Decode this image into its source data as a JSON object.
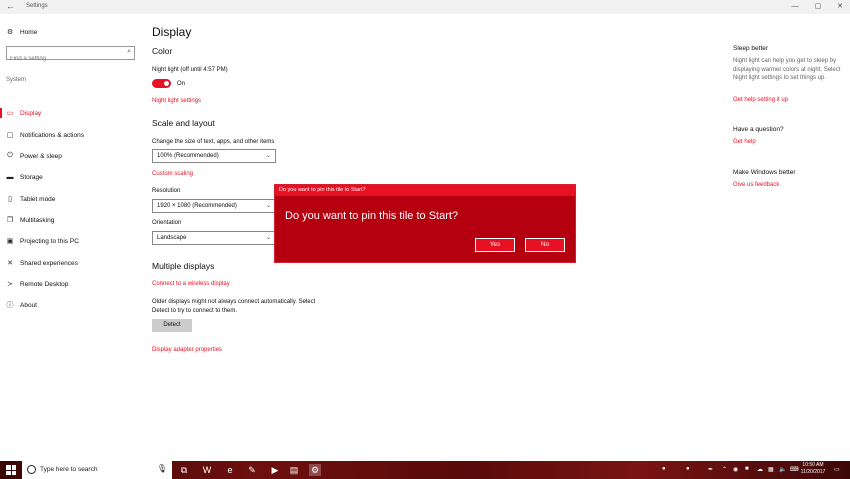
{
  "window": {
    "title": "Settings",
    "back_glyph": "←",
    "min_glyph": "—",
    "max_glyph": "▢",
    "close_glyph": "✕"
  },
  "sidebar": {
    "home_label": "Home",
    "search_placeholder": "Find a setting",
    "section_label": "System",
    "items": [
      {
        "label": "Display",
        "icon": "display-icon",
        "glyph": "▭"
      },
      {
        "label": "Notifications & actions",
        "icon": "notifications-icon",
        "glyph": "▢"
      },
      {
        "label": "Power & sleep",
        "icon": "power-icon",
        "glyph": "⏻"
      },
      {
        "label": "Storage",
        "icon": "storage-icon",
        "glyph": "▬"
      },
      {
        "label": "Tablet mode",
        "icon": "tablet-icon",
        "glyph": "▯"
      },
      {
        "label": "Multitasking",
        "icon": "multitasking-icon",
        "glyph": "❐"
      },
      {
        "label": "Projecting to this PC",
        "icon": "projecting-icon",
        "glyph": "▣"
      },
      {
        "label": "Shared experiences",
        "icon": "shared-icon",
        "glyph": "✕"
      },
      {
        "label": "Remote Desktop",
        "icon": "remote-desktop-icon",
        "glyph": "≻"
      },
      {
        "label": "About",
        "icon": "about-icon",
        "glyph": "ⓘ"
      }
    ]
  },
  "main": {
    "page_title": "Display",
    "color": {
      "heading": "Color",
      "night_light_label": "Night light (off until 4:57 PM)",
      "toggle_state": "On",
      "night_light_settings": "Night light settings"
    },
    "scale": {
      "heading": "Scale and layout",
      "size_label": "Change the size of text, apps, and other items",
      "size_value": "100% (Recommended)",
      "custom_scaling": "Custom scaling",
      "resolution_label": "Resolution",
      "resolution_value": "1920 × 1080 (Recommended)",
      "orientation_label": "Orientation",
      "orientation_value": "Landscape"
    },
    "multiple": {
      "heading": "Multiple displays",
      "wireless_link": "Connect to a wireless display",
      "older_line1": "Older displays might not always connect automatically. Select",
      "older_line2": "Detect to try to connect to them.",
      "detect_button": "Detect",
      "adapter_link": "Display adapter properties"
    }
  },
  "right": {
    "sleep_heading": "Sleep better",
    "sleep_text": "Night light can help you get to sleep by displaying warmer colors at night. Select Night light settings to set things up.",
    "sleep_link": "Get help setting it up",
    "question_heading": "Have a question?",
    "question_link": "Get help",
    "better_heading": "Make Windows better",
    "better_link": "Give us feedback"
  },
  "dialog": {
    "title": "Do you want to pin this tile to Start?",
    "message": "Do you want to pin this tile to Start?",
    "yes_label": "Yes",
    "no_label": "No"
  },
  "taskbar": {
    "search_placeholder": "Type here to search",
    "time": "10:50 AM",
    "date": "11/20/2017",
    "colors": {
      "accent": "#e81123",
      "dialog_bg": "#b5000f"
    }
  }
}
